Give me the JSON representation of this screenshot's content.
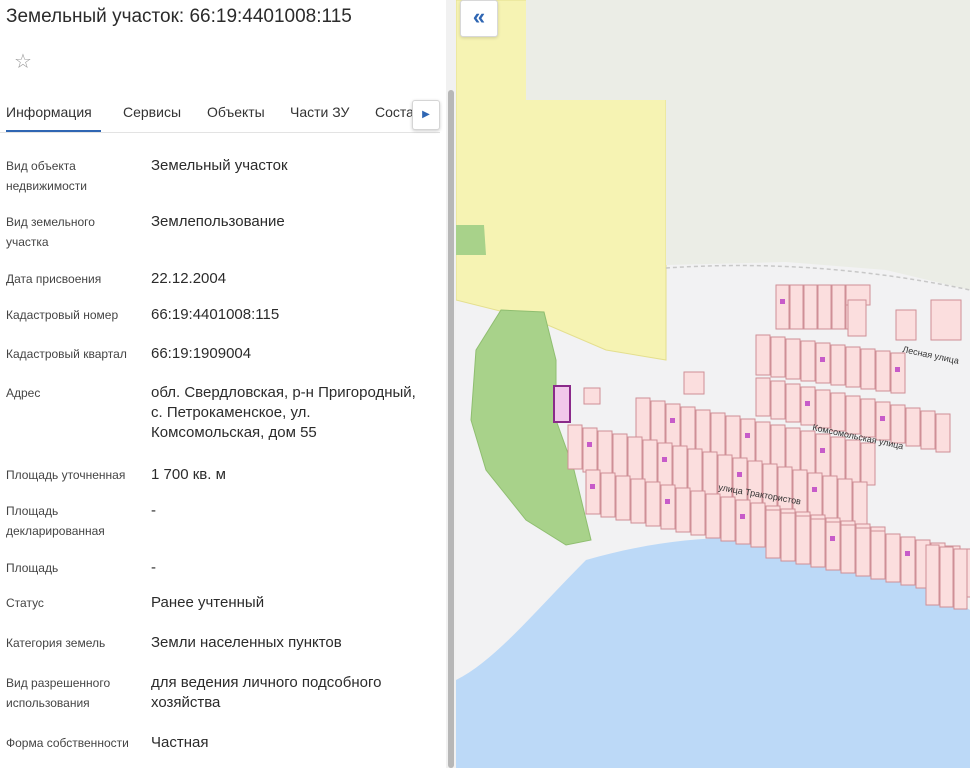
{
  "header": {
    "title": "Земельный участок: 66:19:4401008:115"
  },
  "star_glyph": "☆",
  "tabs": [
    {
      "label": "Информация"
    },
    {
      "label": "Сервисы"
    },
    {
      "label": "Объекты"
    },
    {
      "label": "Части ЗУ"
    },
    {
      "label": "Соста"
    }
  ],
  "tab_arrow_glyph": "▶",
  "collapse_glyph": "«",
  "properties": [
    {
      "label": "Вид объекта недвижимости",
      "value": "Земельный участок"
    },
    {
      "label": "Вид земельного участка",
      "value": "Землепользование"
    },
    {
      "label": "Дата присвоения",
      "value": "22.12.2004"
    },
    {
      "label": "Кадастровый номер",
      "value": "66:19:4401008:115"
    },
    {
      "label": "Кадастровый квартал",
      "value": "66:19:1909004"
    },
    {
      "label": "Адрес",
      "value": "обл. Свердловская, р-н Пригородный, с. Петрокаменское, ул. Комсомольская, дом 55"
    },
    {
      "label": "Площадь уточненная",
      "value": "1 700 кв. м"
    },
    {
      "label": "Площадь декларированная",
      "value": "-"
    },
    {
      "label": "Площадь",
      "value": "-"
    },
    {
      "label": "Статус",
      "value": "Ранее учтенный"
    },
    {
      "label": "Категория земель",
      "value": "Земли населенных пунктов"
    },
    {
      "label": "Вид разрешенного использования",
      "value": "для ведения личного подсобного хозяйства"
    },
    {
      "label": "Форма собственности",
      "value": "Частная"
    }
  ],
  "map": {
    "streets": [
      "Лесная улица",
      "Комсомольская улица",
      "улица Трактористов"
    ],
    "colors": {
      "water": "#bcd9f7",
      "forest": "#a8d28a",
      "field": "#f6f3b3",
      "parcel_fill": "#fbdede",
      "parcel_stroke": "#cf8f96",
      "selected": "#8a2a8a"
    }
  }
}
